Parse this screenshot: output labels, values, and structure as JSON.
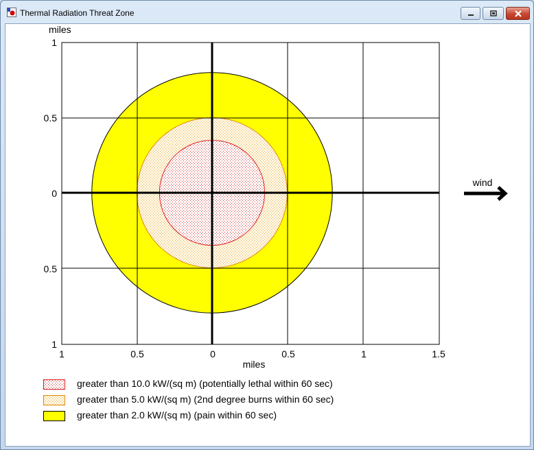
{
  "window": {
    "title": "Thermal Radiation Threat Zone",
    "minimize_label": "minimize",
    "maximize_label": "maximize",
    "close_label": "close"
  },
  "plot": {
    "y_unit": "miles",
    "x_unit": "miles",
    "y_ticks": [
      "1",
      "0.5",
      "0",
      "0.5",
      "1"
    ],
    "x_ticks": [
      "1",
      "0.5",
      "0",
      "0.5",
      "1",
      "1.5"
    ],
    "wind_label": "wind"
  },
  "zones": [
    {
      "label": "greater than 10.0 kW/(sq m) (potentially lethal within 60 sec)",
      "radius_miles": 0.35,
      "fill": "#ffffff",
      "stroke": "#e02020",
      "dot": "#cc3333",
      "pattern": "dots-red"
    },
    {
      "label": "greater than 5.0 kW/(sq m) (2nd degree burns within 60 sec)",
      "radius_miles": 0.5,
      "fill": "#fff6e0",
      "stroke": "#e08a00",
      "dot": "#e0b060",
      "pattern": "dots-orange"
    },
    {
      "label": "greater than 2.0 kW/(sq m) (pain within 60 sec)",
      "radius_miles": 0.8,
      "fill": "#ffff00",
      "stroke": "#000000",
      "pattern": "solid"
    }
  ],
  "colors": {
    "window_frame": "#c4d7ec",
    "close_button": "#c74732",
    "axis": "#000000",
    "grid": "#000000"
  }
}
